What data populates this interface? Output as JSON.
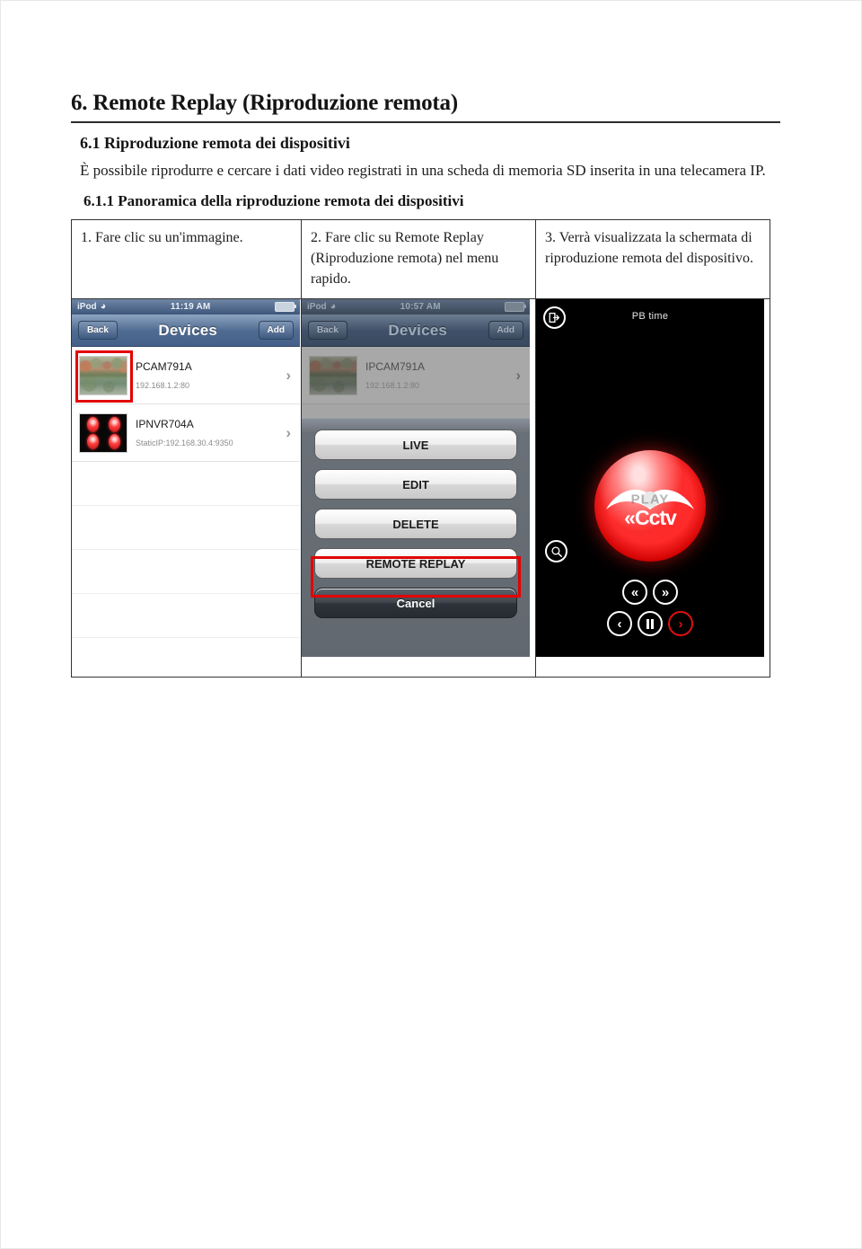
{
  "document": {
    "title": "6. Remote Replay (Riproduzione remota)",
    "section_title": "6.1 Riproduzione remota dei dispositivi",
    "body_paragraph": "È possibile riprodurre e cercare i dati video registrati in una scheda di memoria SD inserita in una telecamera IP.",
    "subsection_title": "6.1.1 Panoramica della riproduzione remota dei dispositivi"
  },
  "steps": [
    {
      "text": "1. Fare clic su un'immagine."
    },
    {
      "text": "2. Fare clic su Remote Replay (Riproduzione remota) nel menu rapido."
    },
    {
      "text": "3. Verrà visualizzata la schermata di riproduzione remota del dispositivo."
    }
  ],
  "screenshot_1": {
    "status_bar": {
      "carrier": "iPod",
      "wifi_icon": "wifi-icon",
      "time": "11:19 AM",
      "battery_icon": "battery-icon"
    },
    "nav_bar": {
      "back_label": "Back",
      "title": "Devices",
      "add_label": "Add"
    },
    "devices": [
      {
        "name": "PCAM791A",
        "ip": "192.168.1.2:80",
        "thumb": "scene-thumbnail",
        "chevron": "chevron-right-icon",
        "highlighted": true
      },
      {
        "name": "IPNVR704A",
        "ip": "StaticIP:192.168.30.4:9350",
        "thumb": "nvr-quad-thumbnail",
        "chevron": "chevron-right-icon",
        "highlighted": false
      }
    ],
    "empty_row_count": 4
  },
  "screenshot_2": {
    "status_bar": {
      "carrier": "iPod",
      "wifi_icon": "wifi-icon",
      "time": "10:57 AM",
      "battery_icon": "battery-icon"
    },
    "nav_bar": {
      "back_label": "Back",
      "title": "Devices",
      "add_label": "Add"
    },
    "devices": [
      {
        "name": "IPCAM791A",
        "ip": "192.168.1.2:80",
        "thumb": "scene-thumbnail",
        "chevron": "chevron-right-icon"
      }
    ],
    "action_sheet": {
      "buttons": [
        {
          "label": "LIVE",
          "highlighted": false
        },
        {
          "label": "EDIT",
          "highlighted": false
        },
        {
          "label": "DELETE",
          "highlighted": false
        },
        {
          "label": "REMOTE REPLAY",
          "highlighted": true
        }
      ],
      "cancel_label": "Cancel"
    }
  },
  "screenshot_3": {
    "exit_icon": "exit-icon",
    "pb_time_label": "PB time",
    "logo": {
      "play_watermark": "PLAY",
      "brand_text": "Cctv",
      "eye_icon": "eye-logo-icon"
    },
    "search_icon": "search-icon",
    "controls": [
      {
        "name": "rewind-button",
        "glyph": "«",
        "active": false
      },
      {
        "name": "fast-forward-button",
        "glyph": "»",
        "active": false
      },
      {
        "name": "previous-button",
        "glyph": "‹",
        "active": false
      },
      {
        "name": "pause-button",
        "glyph": "pause",
        "active": false
      },
      {
        "name": "next-button",
        "glyph": "›",
        "active": true
      }
    ]
  },
  "colors": {
    "highlight_red": "#e40000",
    "nav_blue": "#4f6b90",
    "logo_red": "#ff2a2a"
  }
}
